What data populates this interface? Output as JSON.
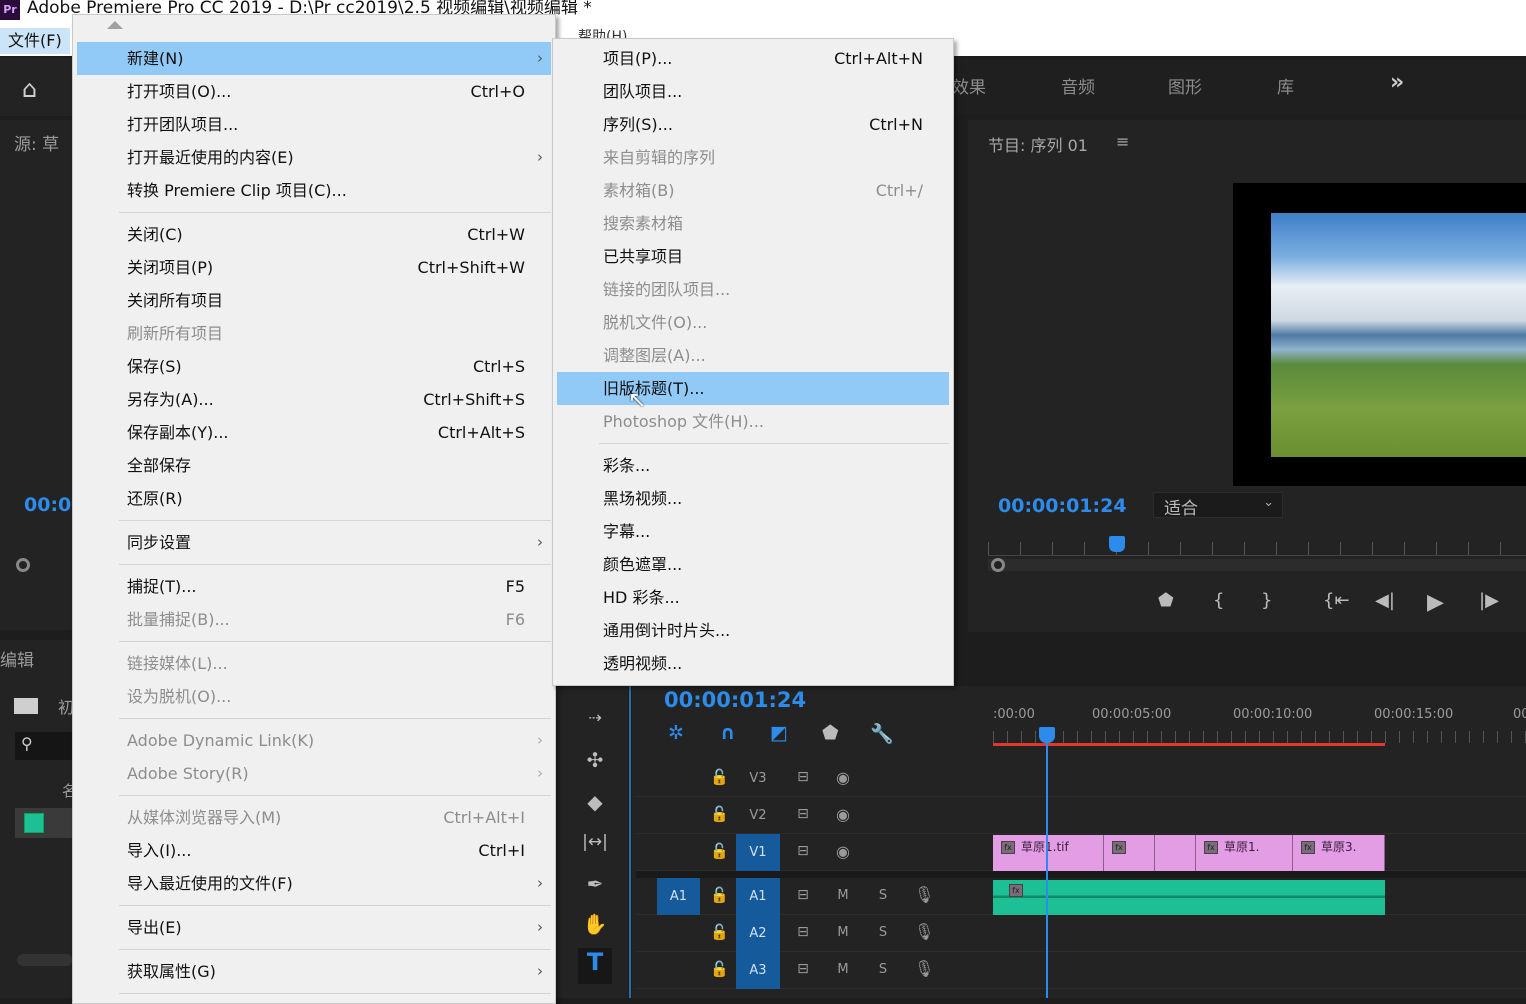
{
  "window": {
    "title": "Adobe Premiere Pro CC 2019 - D:\\Pr cc2019\\2.5 视频编辑\\视频编辑 *",
    "logo": "Pr"
  },
  "menubar": {
    "file": "文件(F)",
    "help": "帮助(H)"
  },
  "file_menu": [
    {
      "label": "新建(N)",
      "submenu": true,
      "highlighted": true
    },
    {
      "label": "打开项目(O)...",
      "shortcut": "Ctrl+O"
    },
    {
      "label": "打开团队项目..."
    },
    {
      "label": "打开最近使用的内容(E)",
      "submenu": true
    },
    {
      "label": "转换 Premiere Clip 项目(C)..."
    },
    {
      "separator": true
    },
    {
      "label": "关闭(C)",
      "shortcut": "Ctrl+W"
    },
    {
      "label": "关闭项目(P)",
      "shortcut": "Ctrl+Shift+W"
    },
    {
      "label": "关闭所有项目"
    },
    {
      "label": "刷新所有项目",
      "disabled": true
    },
    {
      "label": "保存(S)",
      "shortcut": "Ctrl+S"
    },
    {
      "label": "另存为(A)...",
      "shortcut": "Ctrl+Shift+S"
    },
    {
      "label": "保存副本(Y)...",
      "shortcut": "Ctrl+Alt+S"
    },
    {
      "label": "全部保存"
    },
    {
      "label": "还原(R)"
    },
    {
      "separator": true
    },
    {
      "label": "同步设置",
      "submenu": true
    },
    {
      "separator": true
    },
    {
      "label": "捕捉(T)...",
      "shortcut": "F5"
    },
    {
      "label": "批量捕捉(B)...",
      "shortcut": "F6",
      "disabled": true
    },
    {
      "separator": true
    },
    {
      "label": "链接媒体(L)...",
      "disabled": true
    },
    {
      "label": "设为脱机(O)...",
      "disabled": true
    },
    {
      "separator": true
    },
    {
      "label": "Adobe Dynamic Link(K)",
      "submenu": true,
      "disabled": true
    },
    {
      "label": "Adobe Story(R)",
      "submenu": true,
      "disabled": true
    },
    {
      "separator": true
    },
    {
      "label": "从媒体浏览器导入(M)",
      "shortcut": "Ctrl+Alt+I",
      "disabled": true
    },
    {
      "label": "导入(I)...",
      "shortcut": "Ctrl+I"
    },
    {
      "label": "导入最近使用的文件(F)",
      "submenu": true
    },
    {
      "separator": true
    },
    {
      "label": "导出(E)",
      "submenu": true
    },
    {
      "separator": true
    },
    {
      "label": "获取属性(G)",
      "submenu": true
    },
    {
      "separator": true
    }
  ],
  "new_submenu": [
    {
      "label": "项目(P)...",
      "shortcut": "Ctrl+Alt+N"
    },
    {
      "label": "团队项目..."
    },
    {
      "label": "序列(S)...",
      "shortcut": "Ctrl+N"
    },
    {
      "label": "来自剪辑的序列",
      "disabled": true
    },
    {
      "label": "素材箱(B)",
      "shortcut": "Ctrl+/",
      "disabled": true
    },
    {
      "label": "搜索素材箱",
      "disabled": true
    },
    {
      "label": "已共享项目"
    },
    {
      "label": "链接的团队项目...",
      "disabled": true
    },
    {
      "label": "脱机文件(O)...",
      "disabled": true
    },
    {
      "label": "调整图层(A)...",
      "disabled": true
    },
    {
      "label": "旧版标题(T)...",
      "highlighted": true
    },
    {
      "label": "Photoshop 文件(H)...",
      "disabled": true
    },
    {
      "separator": true
    },
    {
      "label": "彩条..."
    },
    {
      "label": "黑场视频..."
    },
    {
      "label": "字幕..."
    },
    {
      "label": "颜色遮罩..."
    },
    {
      "label": "HD 彩条..."
    },
    {
      "label": "通用倒计时片头..."
    },
    {
      "label": "透明视频..."
    }
  ],
  "workspace_tabs": [
    "效果",
    "音频",
    "图形",
    "库",
    "»"
  ],
  "source_panel": {
    "title": "源: 草",
    "timecode": "00:0"
  },
  "project_panel": {
    "title": "编辑",
    "bin_label": "初",
    "column": "名"
  },
  "program_monitor": {
    "title": "节目: 序列 01",
    "menu_icon": "≡",
    "timecode": "00:00:01:24",
    "fit": "适合",
    "playhead_fraction": 0.24
  },
  "timeline": {
    "timecode": "00:00:01:24",
    "ruler": [
      ":00:00",
      "00:00:05:00",
      "00:00:10:00",
      "00:00:15:00",
      "00"
    ],
    "playhead_time": "00:00:01:24",
    "video_tracks": [
      "V3",
      "V2",
      "V1"
    ],
    "audio_tracks": [
      "A1",
      "A2",
      "A3"
    ],
    "source_patch": "A1",
    "mute": "M",
    "solo": "S",
    "clips": [
      "草原1.tif",
      "",
      "",
      "草原1.",
      "草原3."
    ]
  },
  "colors": {
    "accent": "#2d8ceb",
    "menu_highlight": "#91c9f7",
    "video_clip": "#e29de4",
    "audio_clip": "#1dbf95",
    "work_area": "#e0392b"
  }
}
